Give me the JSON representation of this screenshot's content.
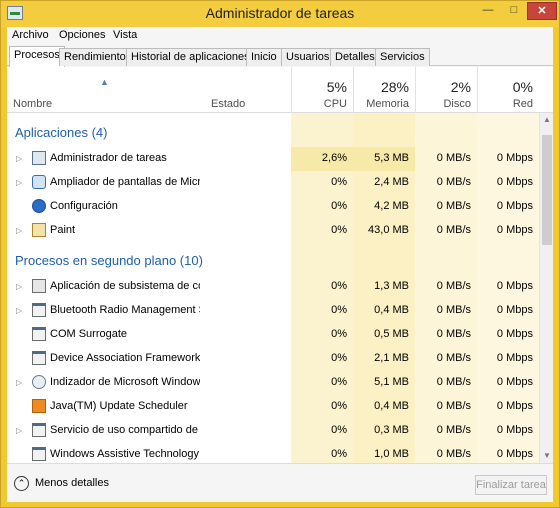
{
  "window": {
    "title": "Administrador de tareas"
  },
  "menu": [
    "Archivo",
    "Opciones",
    "Vista"
  ],
  "tabs": [
    "Procesos",
    "Rendimiento",
    "Historial de aplicaciones",
    "Inicio",
    "Usuarios",
    "Detalles",
    "Servicios"
  ],
  "active_tab": "Procesos",
  "columns": {
    "name": "Nombre",
    "status": "Estado",
    "cpu": {
      "pct": "5%",
      "label": "CPU"
    },
    "memory": {
      "pct": "28%",
      "label": "Memoria"
    },
    "disk": {
      "pct": "2%",
      "label": "Disco"
    },
    "network": {
      "pct": "0%",
      "label": "Red"
    }
  },
  "groups": [
    {
      "title": "Aplicaciones (4)",
      "rows": [
        {
          "name": "Administrador de tareas",
          "expand": true,
          "icon": "task-manager-icon",
          "cpu": "2,6%",
          "mem": "5,3 MB",
          "disk": "0 MB/s",
          "net": "0 Mbps",
          "highlight": true
        },
        {
          "name": "Ampliador de pantallas de Micr...",
          "expand": true,
          "icon": "magnifier-icon",
          "cpu": "0%",
          "mem": "2,4 MB",
          "disk": "0 MB/s",
          "net": "0 Mbps"
        },
        {
          "name": "Configuración",
          "expand": false,
          "icon": "settings-gear-icon",
          "cpu": "0%",
          "mem": "4,2 MB",
          "disk": "0 MB/s",
          "net": "0 Mbps"
        },
        {
          "name": "Paint",
          "expand": true,
          "icon": "paint-icon",
          "cpu": "0%",
          "mem": "43,0 MB",
          "disk": "0 MB/s",
          "net": "0 Mbps"
        }
      ]
    },
    {
      "title": "Procesos en segundo plano (10)",
      "rows": [
        {
          "name": "Aplicación de subsistema de cola",
          "expand": true,
          "icon": "printer-spooler-icon",
          "cpu": "0%",
          "mem": "1,3 MB",
          "disk": "0 MB/s",
          "net": "0 Mbps"
        },
        {
          "name": "Bluetooth Radio Management S...",
          "expand": true,
          "icon": "service-window-icon",
          "cpu": "0%",
          "mem": "0,4 MB",
          "disk": "0 MB/s",
          "net": "0 Mbps"
        },
        {
          "name": "COM Surrogate",
          "expand": false,
          "icon": "service-window-icon",
          "cpu": "0%",
          "mem": "0,5 MB",
          "disk": "0 MB/s",
          "net": "0 Mbps"
        },
        {
          "name": "Device Association Framework ...",
          "expand": false,
          "icon": "service-window-icon",
          "cpu": "0%",
          "mem": "2,1 MB",
          "disk": "0 MB/s",
          "net": "0 Mbps"
        },
        {
          "name": "Indizador de Microsoft Window...",
          "expand": true,
          "icon": "search-indexer-icon",
          "cpu": "0%",
          "mem": "5,1 MB",
          "disk": "0 MB/s",
          "net": "0 Mbps"
        },
        {
          "name": "Java(TM) Update Scheduler",
          "expand": false,
          "icon": "java-icon",
          "cpu": "0%",
          "mem": "0,4 MB",
          "disk": "0 MB/s",
          "net": "0 Mbps"
        },
        {
          "name": "Servicio de uso compartido de r...",
          "expand": true,
          "icon": "sharing-service-icon",
          "cpu": "0%",
          "mem": "0,3 MB",
          "disk": "0 MB/s",
          "net": "0 Mbps"
        },
        {
          "name": "Windows Assistive Technology ...",
          "expand": false,
          "icon": "service-window-icon",
          "cpu": "0%",
          "mem": "1,0 MB",
          "disk": "0 MB/s",
          "net": "0 Mbps"
        }
      ]
    }
  ],
  "footer": {
    "fewer_details": "Menos detalles",
    "end_task": "Finalizar tarea"
  },
  "colors": {
    "cpu_col": "#fbf3cf",
    "mem_col": "#fbf1c4",
    "highlight": "#f7e9a8",
    "group_title": "#1d5fa8",
    "title_bar": "#f3cd3d"
  },
  "icons": {
    "minimize": "minimize-icon",
    "maximize": "maximize-icon",
    "close": "close-icon",
    "sort": "sort-ascending-icon",
    "expand": "expand-chevron-icon",
    "fewer": "chevron-up-icon"
  }
}
